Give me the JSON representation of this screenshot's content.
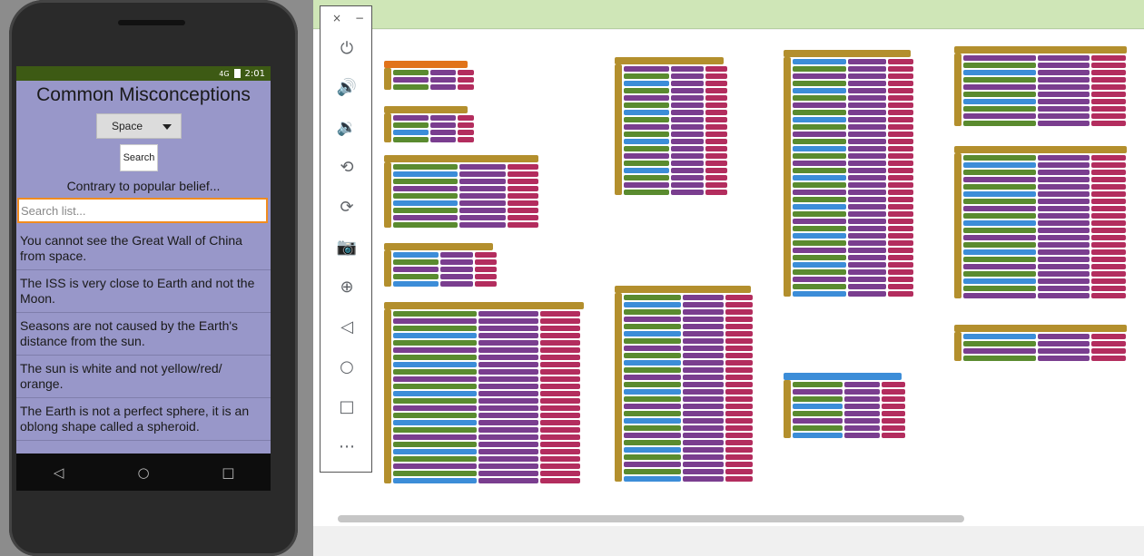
{
  "phone": {
    "status": {
      "signal": "4G",
      "time": "2:01"
    },
    "app_title": "Common Misconceptions",
    "spinner_value": "Space",
    "search_button": "Search",
    "subtitle": "Contrary to popular belief...",
    "search_placeholder": "Search list...",
    "list_items": [
      "You cannot see the Great Wall of China from space.",
      "The ISS is very close to Earth and not the Moon.",
      "Seasons are not caused by the Earth's distance from the sun.",
      "The sun is white and not yellow/red/ orange.",
      "The Earth is not a perfect sphere, it is an oblong shape called a spheroid."
    ],
    "nav": {
      "back": "◁",
      "home": "○",
      "recent": "□"
    }
  },
  "toolbar": {
    "close": "×",
    "minimize": "−",
    "icons": [
      "power-icon",
      "volume-up-icon",
      "volume-down-icon",
      "rotate-left-icon",
      "rotate-right-icon",
      "camera-icon",
      "zoom-icon",
      "back-icon",
      "home-icon",
      "overview-icon",
      "more-icon"
    ],
    "glyphs": [
      "⏻",
      "🔊",
      "🔉",
      "⟲",
      "⟳",
      "📷",
      "⊕",
      "◁",
      "○",
      "□",
      "⋯"
    ]
  },
  "colors": {
    "phone_screen": "#9897c9",
    "status_bar": "#3d5a14",
    "canvas_header": "#cfe6b7",
    "block_event": "#b38f2d",
    "block_control": "#5a8b2f",
    "block_procedure": "#7a3e8f",
    "block_text": "#b32d5e",
    "block_list": "#e1731a",
    "block_logic": "#3c8dd8"
  }
}
